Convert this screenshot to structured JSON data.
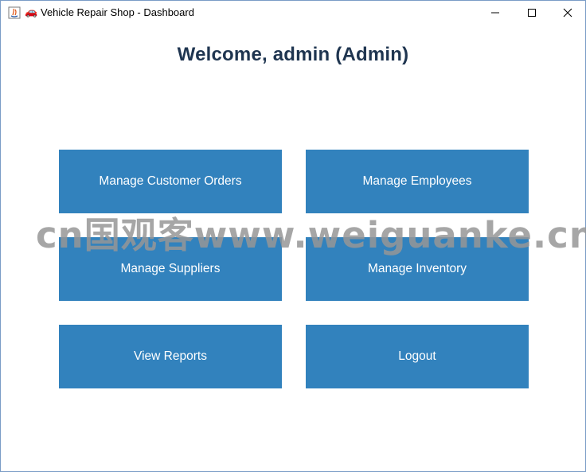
{
  "window": {
    "title_emoji": "🚗",
    "title": "Vehicle Repair Shop - Dashboard"
  },
  "welcome": "Welcome, admin (Admin)",
  "buttons": {
    "customer_orders": "Manage Customer Orders",
    "employees": "Manage Employees",
    "suppliers": "Manage Suppliers",
    "inventory": "Manage Inventory",
    "reports": "View Reports",
    "logout": "Logout"
  },
  "watermark": "cn国观客www.weiguanke.cn",
  "colors": {
    "tile": "#3282bd",
    "heading": "#1f3550"
  }
}
